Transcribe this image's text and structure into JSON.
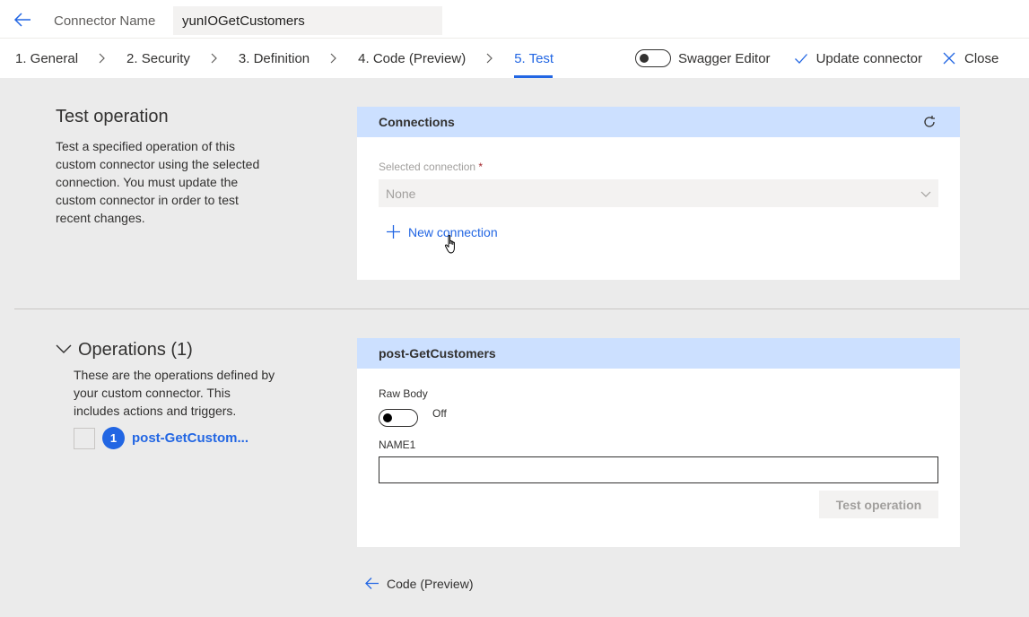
{
  "header": {
    "connector_name_label": "Connector Name",
    "connector_name_value": "yunIOGetCustomers"
  },
  "steps": [
    {
      "label": "1. General"
    },
    {
      "label": "2. Security"
    },
    {
      "label": "3. Definition"
    },
    {
      "label": "4. Code (Preview)"
    },
    {
      "label": "5. Test",
      "active": true
    }
  ],
  "toolbar": {
    "swagger_label": "Swagger Editor",
    "swagger_on": false,
    "update_label": "Update connector",
    "close_label": "Close"
  },
  "test_section": {
    "title": "Test operation",
    "description": "Test a specified operation of this custom connector using the selected connection. You must update the custom connector in order to test recent changes."
  },
  "connections_card": {
    "title": "Connections",
    "selected_label": "Selected connection",
    "required_mark": "*",
    "selected_value": "None",
    "new_connection_label": "New connection"
  },
  "operations": {
    "title": "Operations (1)",
    "description": "These are the operations defined by your custom connector. This includes actions and triggers.",
    "items": [
      {
        "index": "1",
        "name": "post-GetCustom..."
      }
    ]
  },
  "operation_card": {
    "title": "post-GetCustomers",
    "raw_body_label": "Raw Body",
    "raw_body_state": "Off",
    "field_label": "NAME1",
    "field_value": "",
    "test_button_label": "Test operation"
  },
  "footer": {
    "back_label": "Code (Preview)"
  },
  "colors": {
    "accent": "#2266e3",
    "card_header": "#cce0ff",
    "background": "#ebebeb"
  }
}
